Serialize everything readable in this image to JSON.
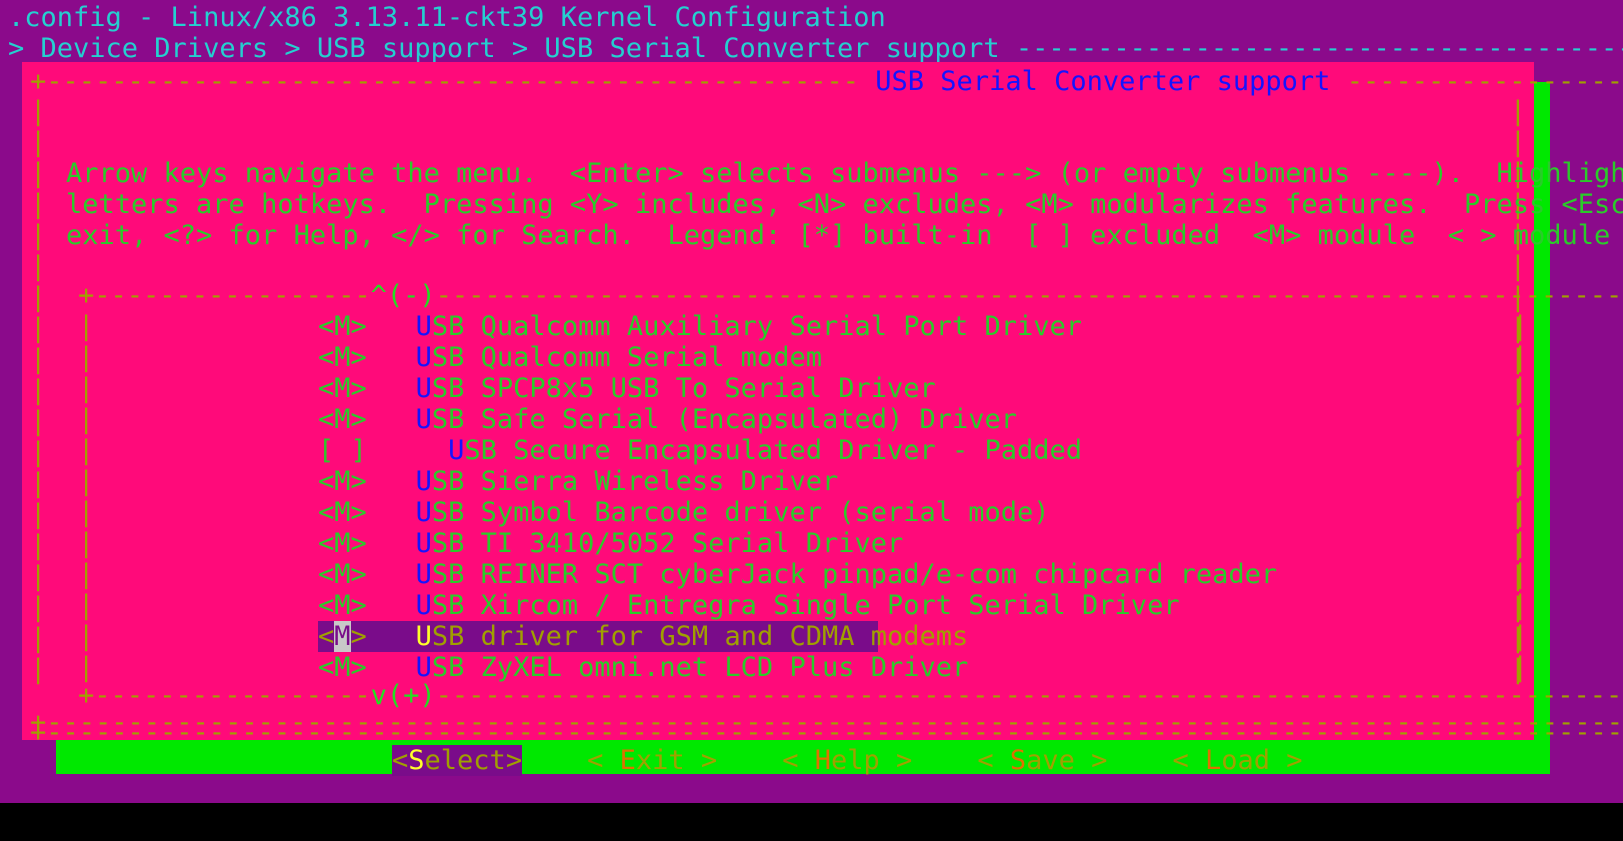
{
  "terminal": {
    "title": ".config - Linux/x86 3.13.11-ckt39 Kernel Configuration",
    "breadcrumb": "> Device Drivers > USB support > USB Serial Converter support ",
    "breadcrumb_rule": "----------------------------------------------------------"
  },
  "dialog": {
    "title": "USB Serial Converter support",
    "top_left_rule": "+-------------------------------------------------- ",
    "top_right_rule": " ------------------------------------------------+",
    "separator_rule": "+-----------------------------------------------------------------------------------------------------------------+",
    "bottom_rule": "+-----------------------------------------------------------------------------------------------------------------+",
    "help": [
      "Arrow keys navigate the menu.  <Enter> selects submenus ---> (or empty submenus ----).  Highlighted",
      "letters are hotkeys.  Pressing <Y> includes, <N> excludes, <M> modularizes features.  Press <Esc><Esc> to",
      "exit, <?> for Help, </> for Search.  Legend: [*] built-in  [ ] excluded  <M> module  < > module capable"
    ]
  },
  "menu": {
    "scroll_up_left_rule": "+-----------------",
    "scroll_up_marker": "^(-)",
    "scroll_up_right_rule": "--------------------------------------------------------------------------------------------------+",
    "scroll_down_left_rule": "+-----------------",
    "scroll_down_marker": "v(+)",
    "scroll_down_right_rule": "--------------------------------------------------------------------------------------------------+",
    "items": [
      {
        "state": "<M>",
        "indent": "",
        "hotkey": "U",
        "rest": "SB Qualcomm Auxiliary Serial Port Driver",
        "selected": false
      },
      {
        "state": "<M>",
        "indent": "",
        "hotkey": "U",
        "rest": "SB Qualcomm Serial modem",
        "selected": false
      },
      {
        "state": "<M>",
        "indent": "",
        "hotkey": "U",
        "rest": "SB SPCP8x5 USB To Serial Driver",
        "selected": false
      },
      {
        "state": "<M>",
        "indent": "",
        "hotkey": "U",
        "rest": "SB Safe Serial (Encapsulated) Driver",
        "selected": false
      },
      {
        "state": "[ ]",
        "indent": "  ",
        "hotkey": "U",
        "rest": "SB Secure Encapsulated Driver - Padded",
        "selected": false
      },
      {
        "state": "<M>",
        "indent": "",
        "hotkey": "U",
        "rest": "SB Sierra Wireless Driver",
        "selected": false
      },
      {
        "state": "<M>",
        "indent": "",
        "hotkey": "U",
        "rest": "SB Symbol Barcode driver (serial mode)",
        "selected": false
      },
      {
        "state": "<M>",
        "indent": "",
        "hotkey": "U",
        "rest": "SB TI 3410/5052 Serial Driver",
        "selected": false
      },
      {
        "state": "<M>",
        "indent": "",
        "hotkey": "U",
        "rest": "SB REINER SCT cyberJack pinpad/e-com chipcard reader",
        "selected": false
      },
      {
        "state": "<M>",
        "indent": "",
        "hotkey": "U",
        "rest": "SB Xircom / Entregra Single Port Serial Driver",
        "selected": false
      },
      {
        "state": "<M>",
        "indent": "",
        "hotkey": "U",
        "rest": "SB driver for GSM and CDMA modems",
        "selected": true
      },
      {
        "state": "<M>",
        "indent": "",
        "hotkey": "U",
        "rest": "SB ZyXEL omni.net LCD Plus Driver",
        "selected": false
      }
    ]
  },
  "buttons": [
    {
      "open": "<",
      "hotkey": "S",
      "rest": "elect",
      "close": ">",
      "active": true
    },
    {
      "open": "< ",
      "hotkey": "E",
      "rest": "xit ",
      "close": ">",
      "active": false
    },
    {
      "open": "< ",
      "hotkey": "H",
      "rest": "elp ",
      "close": ">",
      "active": false
    },
    {
      "open": "< ",
      "hotkey": "S",
      "rest": "ave ",
      "close": ">",
      "active": false
    },
    {
      "open": "< ",
      "hotkey": "L",
      "rest": "oad ",
      "close": ">",
      "active": false
    }
  ],
  "colors": {
    "background": "#8B0A8B",
    "dialog": "#FF0A7A",
    "shadow": "#00E800",
    "border": "#A0A000",
    "header_text": "#24D0D0",
    "menu_text": "#2ACB2A",
    "hotkey": "#1414FF",
    "title_text": "#1414FF",
    "selected_bg": "#7A0C8A",
    "selected_hotkey": "#FFFF2A",
    "cursor": "#C8C8C8",
    "button_hotkey": "#E07000"
  }
}
